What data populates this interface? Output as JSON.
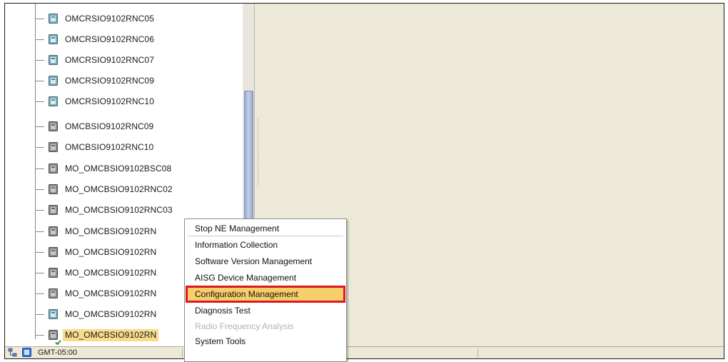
{
  "tree": {
    "nodes": [
      {
        "label": "OMCRSIO9102RNC05",
        "icon": "rnc-node-icon",
        "selected": false
      },
      {
        "label": "OMCRSIO9102RNC06",
        "icon": "rnc-node-icon",
        "selected": false
      },
      {
        "label": "OMCRSIO9102RNC07",
        "icon": "rnc-node-icon",
        "selected": false
      },
      {
        "label": "OMCRSIO9102RNC09",
        "icon": "rnc-node-icon",
        "selected": false
      },
      {
        "label": "OMCRSIO9102RNC10",
        "icon": "rnc-node-icon",
        "selected": false
      },
      {
        "label": "OMCBSIO9102RNC09",
        "icon": "ne-node-icon",
        "selected": false
      },
      {
        "label": "OMCBSIO9102RNC10",
        "icon": "ne-node-icon",
        "selected": false
      },
      {
        "label": "MO_OMCBSIO9102BSC08",
        "icon": "ne-node-icon",
        "selected": false
      },
      {
        "label": "MO_OMCBSIO9102RNC02",
        "icon": "ne-node-icon",
        "selected": false
      },
      {
        "label": "MO_OMCBSIO9102RNC03",
        "icon": "ne-node-icon",
        "selected": false
      },
      {
        "label": "MO_OMCBSIO9102RN",
        "icon": "ne-node-icon",
        "selected": false
      },
      {
        "label": "MO_OMCBSIO9102RN",
        "icon": "ne-node-icon",
        "selected": false
      },
      {
        "label": "MO_OMCBSIO9102RN",
        "icon": "ne-node-icon",
        "selected": false
      },
      {
        "label": "MO_OMCBSIO9102RN",
        "icon": "ne-node-icon",
        "selected": false
      },
      {
        "label": "MO_OMCBSIO9102RN",
        "icon": "rnc-node-icon",
        "selected": false
      },
      {
        "label": "MO_OMCBSIO9102RN",
        "icon": "ne-node-checked-icon",
        "selected": true
      }
    ]
  },
  "context_menu": {
    "items": [
      {
        "label": "Stop NE Management",
        "enabled": true,
        "highlighted": false
      },
      {
        "label": "Information Collection",
        "enabled": true,
        "highlighted": false
      },
      {
        "label": "Software Version Management",
        "enabled": true,
        "highlighted": false
      },
      {
        "label": "AISG Device Management",
        "enabled": true,
        "highlighted": false
      },
      {
        "label": "Configuration Management",
        "enabled": true,
        "highlighted": true
      },
      {
        "label": "Diagnosis Test",
        "enabled": true,
        "highlighted": false
      },
      {
        "label": "Radio Frequency Analysis",
        "enabled": false,
        "highlighted": false
      },
      {
        "label": "System Tools",
        "enabled": true,
        "highlighted": false
      }
    ]
  },
  "status_bar": {
    "timezone": "GMT-05:00",
    "icons": [
      "network-icon",
      "status-icon"
    ]
  },
  "colors": {
    "selection": "#f7dc8c",
    "menu_highlight": "#f6cf6b",
    "annotation_box": "#e0161d",
    "background": "#ece9d8"
  }
}
